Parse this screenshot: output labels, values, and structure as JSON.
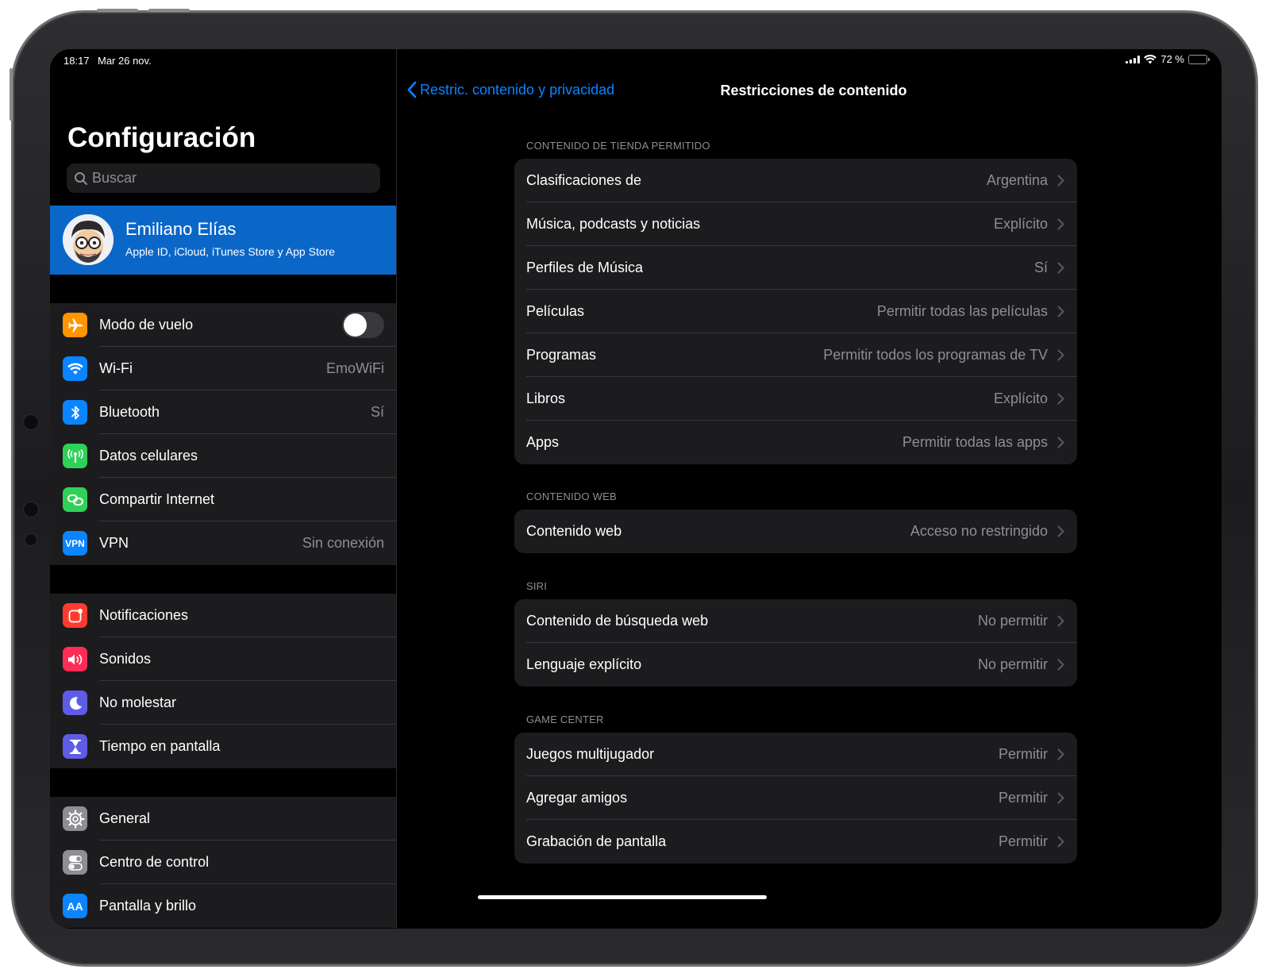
{
  "status_bar": {
    "time": "18:17",
    "date": "Mar 26 nov.",
    "battery": "72 %",
    "battery_level": 0.72
  },
  "sidebar": {
    "title": "Configuración",
    "search_placeholder": "Buscar",
    "profile": {
      "name": "Emiliano Elías",
      "subtitle": "Apple ID, iCloud, iTunes Store y App Store"
    },
    "group1": [
      {
        "label": "Modo de vuelo",
        "value": "",
        "icon": "airplane-icon",
        "color": "#ff9500",
        "toggle": false
      },
      {
        "label": "Wi-Fi",
        "value": "EmoWiFi",
        "icon": "wifi-icon",
        "color": "#0a84ff"
      },
      {
        "label": "Bluetooth",
        "value": "Sí",
        "icon": "bluetooth-icon",
        "color": "#0a84ff"
      },
      {
        "label": "Datos celulares",
        "value": "",
        "icon": "antenna-icon",
        "color": "#30d158"
      },
      {
        "label": "Compartir Internet",
        "value": "",
        "icon": "link-icon",
        "color": "#30d158"
      },
      {
        "label": "VPN",
        "value": "Sin conexión",
        "icon": "vpn-icon",
        "icon_text": "VPN",
        "color": "#0a84ff"
      }
    ],
    "group2": [
      {
        "label": "Notificaciones",
        "icon": "notifications-icon",
        "color": "#ff3b30"
      },
      {
        "label": "Sonidos",
        "icon": "speaker-icon",
        "color": "#ff2d55"
      },
      {
        "label": "No molestar",
        "icon": "moon-icon",
        "color": "#5e5ce6"
      },
      {
        "label": "Tiempo en pantalla",
        "icon": "hourglass-icon",
        "color": "#5e5ce6"
      }
    ],
    "group3": [
      {
        "label": "General",
        "icon": "gear-icon",
        "color": "#8e8e93"
      },
      {
        "label": "Centro de control",
        "icon": "switches-icon",
        "color": "#8e8e93"
      },
      {
        "label": "Pantalla y brillo",
        "icon": "display-icon",
        "icon_text": "AA",
        "color": "#0a84ff"
      }
    ]
  },
  "detail": {
    "back_label": "Restric. contenido y privacidad",
    "title": "Restricciones de contenido",
    "sections": [
      {
        "header": "CONTENIDO DE TIENDA PERMITIDO",
        "rows": [
          {
            "label": "Clasificaciones de",
            "value": "Argentina"
          },
          {
            "label": "Música, podcasts y noticias",
            "value": "Explícito"
          },
          {
            "label": "Perfiles de Música",
            "value": "Sí"
          },
          {
            "label": "Películas",
            "value": "Permitir todas las películas"
          },
          {
            "label": "Programas",
            "value": "Permitir todos los programas de TV"
          },
          {
            "label": "Libros",
            "value": "Explícito"
          },
          {
            "label": "Apps",
            "value": "Permitir todas las apps"
          }
        ]
      },
      {
        "header": "CONTENIDO WEB",
        "rows": [
          {
            "label": "Contenido web",
            "value": "Acceso no restringido"
          }
        ]
      },
      {
        "header": "SIRI",
        "rows": [
          {
            "label": "Contenido de búsqueda web",
            "value": "No permitir"
          },
          {
            "label": "Lenguaje explícito",
            "value": "No permitir"
          }
        ]
      },
      {
        "header": "GAME CENTER",
        "rows": [
          {
            "label": "Juegos multijugador",
            "value": "Permitir"
          },
          {
            "label": "Agregar amigos",
            "value": "Permitir"
          },
          {
            "label": "Grabación de pantalla",
            "value": "Permitir"
          }
        ]
      }
    ]
  },
  "colors": {
    "accent": "#0a84ff",
    "selection": "#0a67c8",
    "cell": "#1c1c1e",
    "secondary_text": "#8e8e93"
  }
}
